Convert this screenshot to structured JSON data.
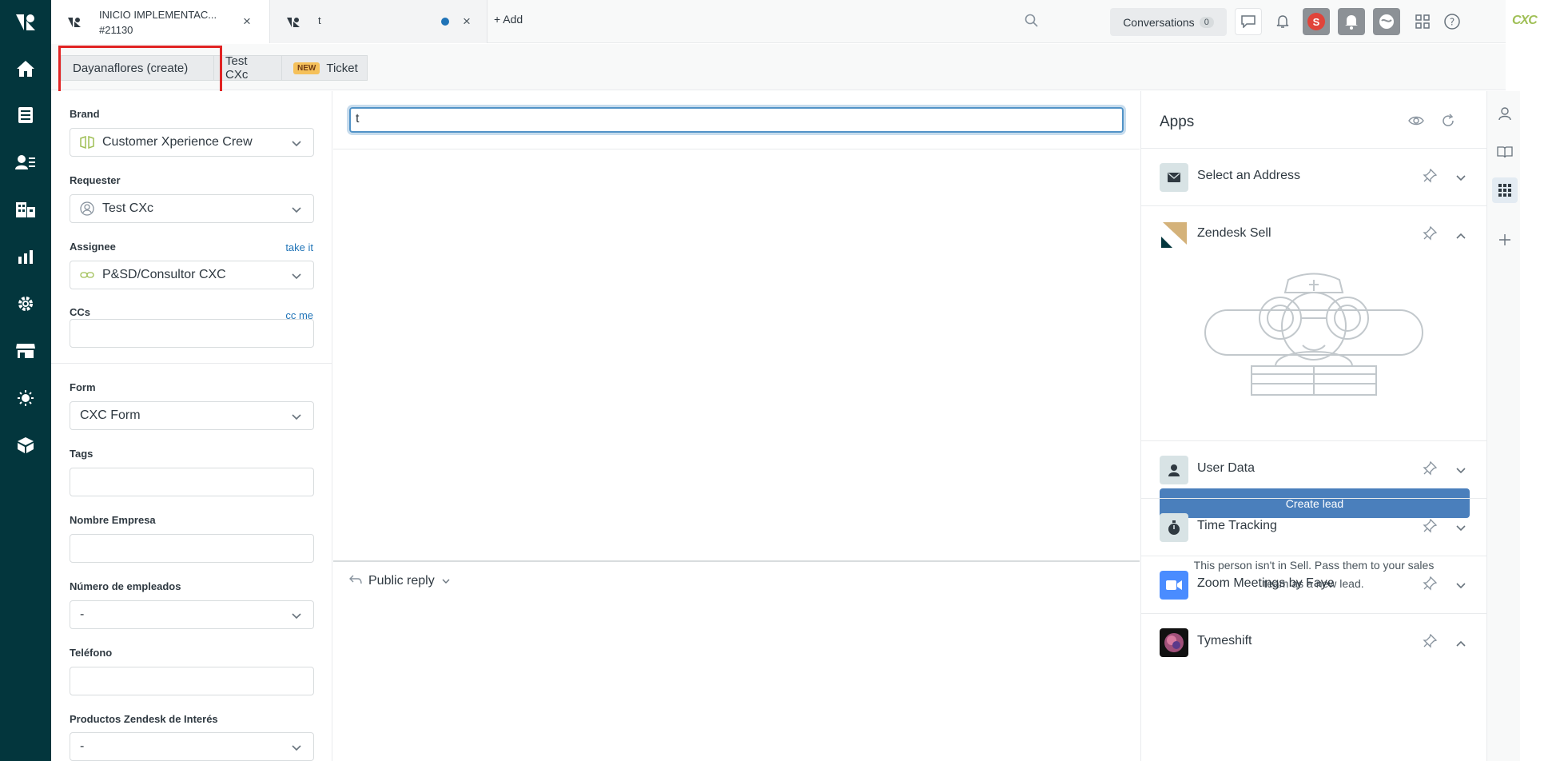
{
  "tabs": [
    {
      "title": "INICIO IMPLEMENTAC...",
      "subtitle": "#21130"
    },
    {
      "title": "t",
      "subtitle": ""
    }
  ],
  "add_label": "Add",
  "conversations": {
    "label": "Conversations",
    "count": "0"
  },
  "brand_logo_text": "CXC",
  "breadcrumbs": [
    {
      "label": "Dayanaflores (create)"
    },
    {
      "label": "Test CXc"
    },
    {
      "badge": "NEW",
      "label": "Ticket"
    }
  ],
  "fields": {
    "brand": {
      "label": "Brand",
      "value": "Customer Xperience Crew"
    },
    "requester": {
      "label": "Requester",
      "value": "Test CXc"
    },
    "assignee": {
      "label": "Assignee",
      "link": "take it",
      "value": "P&SD/Consultor CXC"
    },
    "ccs": {
      "label": "CCs",
      "link": "cc me",
      "value": ""
    },
    "form": {
      "label": "Form",
      "value": "CXC Form"
    },
    "tags": {
      "label": "Tags",
      "value": ""
    },
    "nombre_empresa": {
      "label": "Nombre Empresa",
      "value": ""
    },
    "empleados": {
      "label": "Número de empleados",
      "value": "-"
    },
    "telefono": {
      "label": "Teléfono",
      "value": ""
    },
    "productos": {
      "label": "Productos Zendesk de Interés",
      "value": "-"
    }
  },
  "ticket": {
    "subject": "t",
    "reply_mode": "Public reply"
  },
  "apps": {
    "title": "Apps",
    "items": [
      {
        "name": "Select an Address",
        "icon": "envelope-icon"
      },
      {
        "name": "Zendesk Sell",
        "icon": "zendesk-sell-icon"
      },
      {
        "name": "User Data",
        "icon": "user-icon"
      },
      {
        "name": "Time Tracking",
        "icon": "stopwatch-icon"
      },
      {
        "name": "Zoom Meetings by Faye",
        "icon": "video-icon"
      },
      {
        "name": "Tymeshift",
        "icon": "tymeshift-icon"
      }
    ],
    "sell_message": "This person isn't in Sell. Pass them to your sales team as a new lead.",
    "create_lead": "Create lead"
  },
  "colors": {
    "nav": "#03363d",
    "accent": "#1f73b7",
    "lead_button": "#4a7fbc",
    "highlight": "#e12323"
  }
}
